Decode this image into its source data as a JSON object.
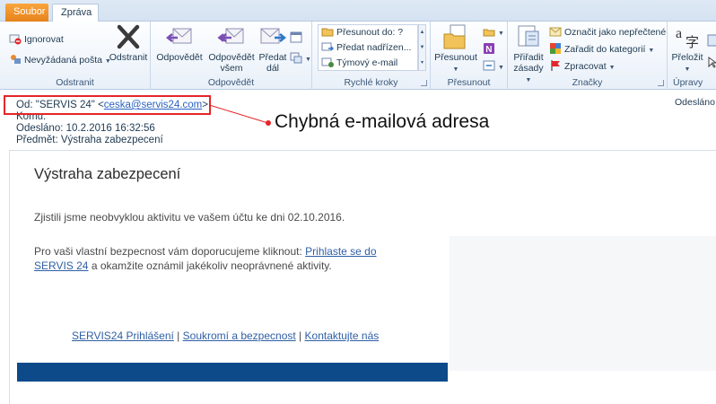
{
  "tabs": {
    "file": "Soubor",
    "message": "Zpráva"
  },
  "ribbon": {
    "delete_group": {
      "label": "Odstranit",
      "ignore": "Ignorovat",
      "junk": "Nevyžádaná pošta",
      "delete": "Odstranit"
    },
    "respond_group": {
      "label": "Odpovědět",
      "reply": "Odpovědět",
      "reply_all_1": "Odpovědět",
      "reply_all_2": "všem",
      "forward_1": "Předat",
      "forward_2": "dál"
    },
    "quick_steps": {
      "label": "Rychlé kroky",
      "items": [
        "Přesunout do: ?",
        "Předat nadřízen...",
        "Týmový e-mail"
      ]
    },
    "move_group": {
      "label": "Přesunout",
      "move": "Přesunout"
    },
    "tags_group": {
      "label": "Značky",
      "rules_1": "Přiřadit",
      "rules_2": "zásady",
      "mark_unread": "Označit jako nepřečtené",
      "categorize": "Zařadit do kategorií",
      "follow_up": "Zpracovat"
    },
    "editing_group": {
      "label": "Úpravy",
      "translate": "Přeložit"
    }
  },
  "header": {
    "from_label": "Od:",
    "from_name": "\"SERVIS 24\"",
    "from_email_open": "<",
    "from_email": "ceska@servis24.com",
    "from_email_close": ">",
    "to_label": "Komu:",
    "sent_label": "Odesláno:",
    "sent_value": "10.2.2016 16:32:56",
    "subject_label": "Předmět:",
    "subject_value": "Výstraha zabezpecení",
    "sent_right": "Odesláno:"
  },
  "annotation": {
    "callout": "Chybná e-mailová adresa"
  },
  "email": {
    "title": "Výstraha zabezpecení",
    "p1": "Zjistili jsme neobvyklou aktivitu ve vašem účtu ke dni 02.10.2016.",
    "p2_start": "Pro vaši vlastní bezpecnost vám doporucujeme kliknout: ",
    "p2_link": "Prihlaste se do SERVIS 24",
    "p2_end": " a okamžite oznámil jakékoliv neoprávnené aktivity.",
    "footer_links": [
      "SERVIS24 Prihlášení",
      "Soukromí a bezpecnost",
      "Kontaktujte nás"
    ],
    "footer_sep": " | "
  },
  "colors": {
    "accent_orange": "#e6821c",
    "annotation_red": "#e3262a",
    "link_blue": "#2f5fa5",
    "bar_blue": "#0c4a8a"
  }
}
